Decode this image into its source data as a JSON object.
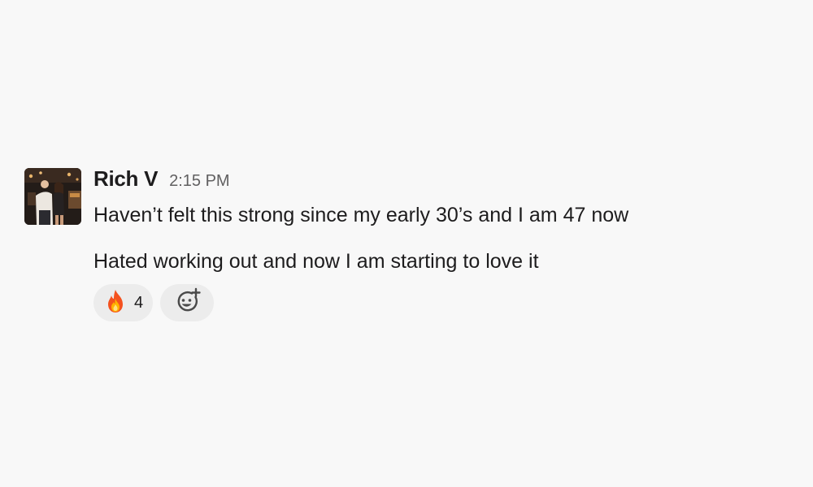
{
  "message": {
    "sender": "Rich V",
    "timestamp": "2:15 PM",
    "lines": [
      "Haven’t felt this strong since my early 30’s and I am 47 now",
      "Hated working out and now I am starting to love it"
    ],
    "reactions": [
      {
        "emoji_icon": "fire-icon",
        "count": "4"
      }
    ],
    "add_reaction_icon": "add-emoji-icon"
  }
}
